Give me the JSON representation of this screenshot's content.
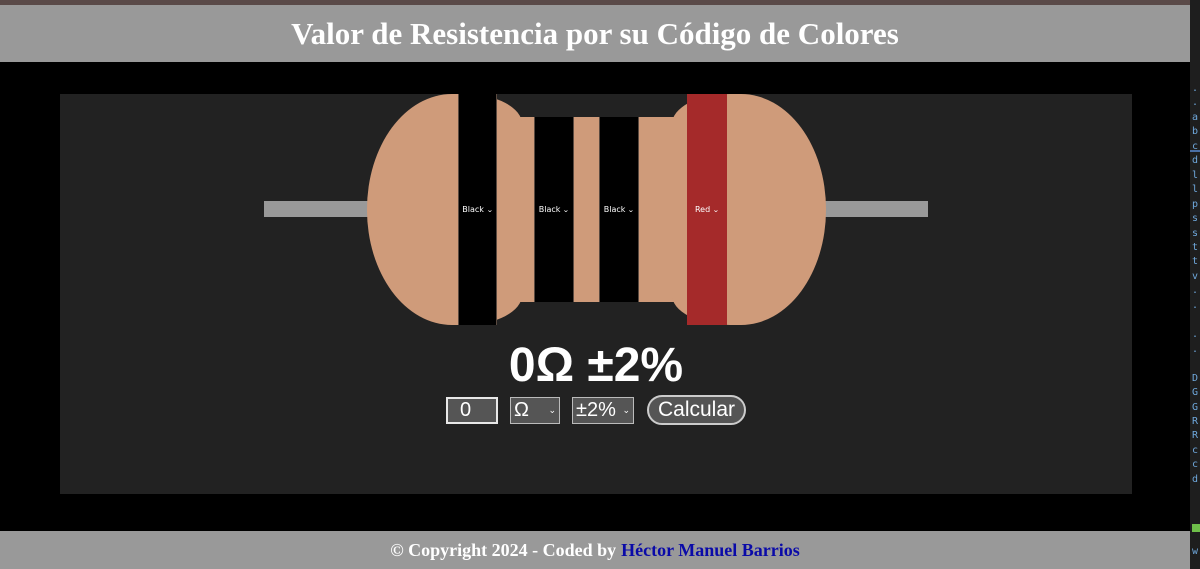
{
  "header": {
    "title": "Valor de Resistencia por su Código de Colores"
  },
  "resistor": {
    "body_color": "#cf9b7a",
    "lead_color": "#999999",
    "bands": [
      {
        "label": "Black",
        "color": "#000000"
      },
      {
        "label": "Black",
        "color": "#000000"
      },
      {
        "label": "Black",
        "color": "#000000"
      },
      {
        "label": "Red",
        "color": "#a52a2a"
      }
    ]
  },
  "result": {
    "text": "0Ω ±2%"
  },
  "controls": {
    "value": "0",
    "unit": "Ω",
    "tolerance": "±2%",
    "calculate_label": "Calcular"
  },
  "footer": {
    "copyright": "© Copyright 2024 - Coded by",
    "author": "Héctor Manuel Barrios"
  },
  "side_panel": {
    "chars": [
      ".",
      ".",
      "a",
      "b",
      "c",
      "d",
      "l",
      "l",
      "p",
      "s",
      "s",
      "t",
      "t",
      "v",
      ".",
      ".",
      ".",
      ".",
      "D",
      "G",
      "G",
      "R",
      "R",
      "c",
      "c",
      "d",
      "w"
    ]
  }
}
